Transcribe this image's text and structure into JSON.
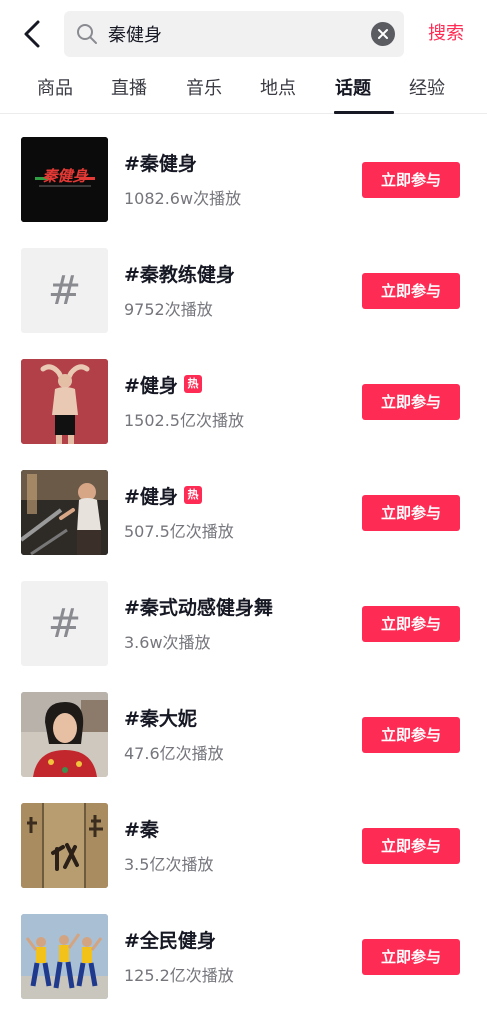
{
  "search": {
    "query": "秦健身",
    "submit_label": "搜索"
  },
  "tabs": [
    {
      "label": "商品",
      "active": false
    },
    {
      "label": "直播",
      "active": false
    },
    {
      "label": "音乐",
      "active": false
    },
    {
      "label": "地点",
      "active": false
    },
    {
      "label": "话题",
      "active": true
    },
    {
      "label": "经验",
      "active": false
    }
  ],
  "topics": [
    {
      "title": "#秦健身",
      "plays": "1082.6w次播放",
      "hot": false,
      "thumb": "qin-jianshen-logo",
      "join_label": "立即参与"
    },
    {
      "title": "#秦教练健身",
      "plays": "9752次播放",
      "hot": false,
      "thumb": "hash-placeholder",
      "join_label": "立即参与"
    },
    {
      "title": "#健身",
      "plays": "1502.5亿次播放",
      "hot": true,
      "hot_label": "热",
      "thumb": "stretching-man",
      "join_label": "立即参与"
    },
    {
      "title": "#健身",
      "plays": "507.5亿次播放",
      "hot": true,
      "hot_label": "热",
      "thumb": "treadmill-woman",
      "join_label": "立即参与"
    },
    {
      "title": "#秦式动感健身舞",
      "plays": "3.6w次播放",
      "hot": false,
      "thumb": "hash-placeholder",
      "join_label": "立即参与"
    },
    {
      "title": "#秦大妮",
      "plays": "47.6亿次播放",
      "hot": false,
      "thumb": "woman-portrait",
      "join_label": "立即参与"
    },
    {
      "title": "#秦",
      "plays": "3.5亿次播放",
      "hot": false,
      "thumb": "ancient-inscription",
      "join_label": "立即参与"
    },
    {
      "title": "#全民健身",
      "plays": "125.2亿次播放",
      "hot": false,
      "thumb": "group-dance",
      "join_label": "立即参与"
    }
  ],
  "colors": {
    "accent": "#fe2c55",
    "text_primary": "#161823",
    "text_secondary": "#75767c",
    "search_bg": "#f1f1f2"
  }
}
